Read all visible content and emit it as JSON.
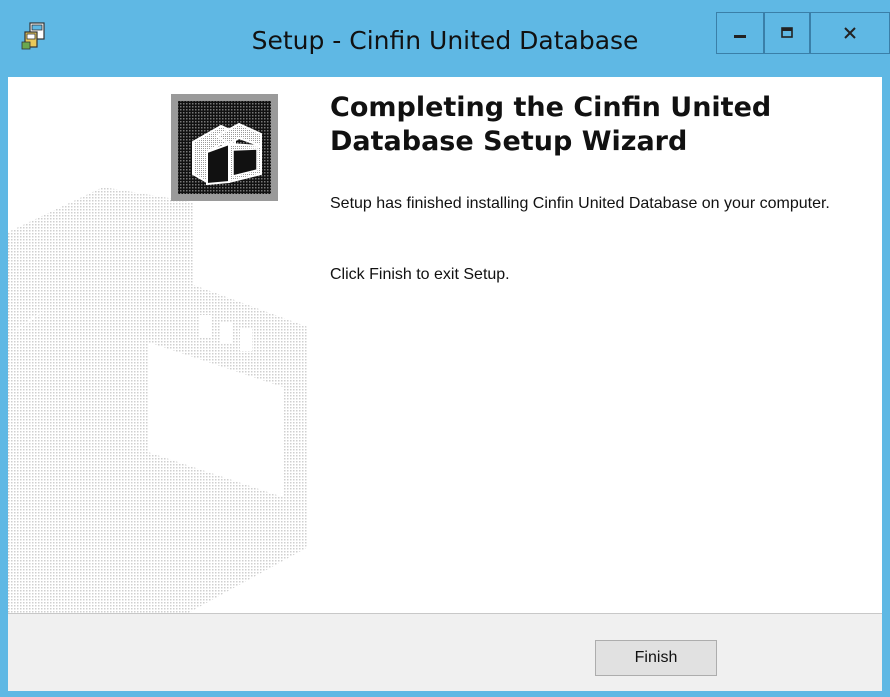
{
  "window": {
    "title": "Setup - Cinfin United Database",
    "controls": {
      "minimize": "minimize",
      "maximize": "maximize",
      "close": "close"
    }
  },
  "main": {
    "heading": "Completing the Cinfin United Database Setup Wizard",
    "paragraph1": "Setup has finished installing Cinfin United Database on your computer.",
    "paragraph2": "Click Finish to exit Setup."
  },
  "footer": {
    "finish_label": "Finish"
  },
  "icons": [
    "app-setup-icon",
    "minimize-icon",
    "maximize-icon",
    "close-icon",
    "setup-wizard-image"
  ]
}
